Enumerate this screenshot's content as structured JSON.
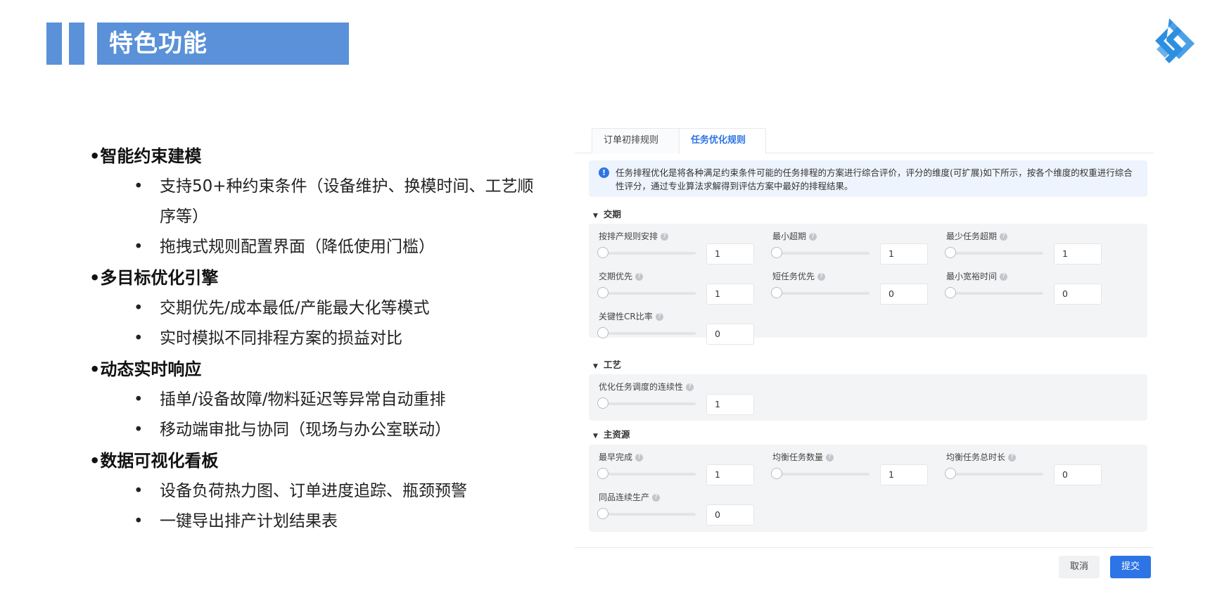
{
  "header": {
    "title": "特色功能",
    "logo_icon": "company-logo-icon",
    "accent_color": "#5a91d9"
  },
  "features": [
    {
      "title": "•智能约束建模",
      "bullets": [
        {
          "line1": "支持50+种约束条件（设备维护、换模时间、工艺顺",
          "line2": "序等）"
        },
        {
          "line1": "拖拽式规则配置界面（降低使用门槛）"
        }
      ]
    },
    {
      "title": "•多目标优化引擎",
      "bullets": [
        {
          "line1": "交期优先/成本最低/产能最大化等模式"
        },
        {
          "line1": "实时模拟不同排程方案的损益对比"
        }
      ]
    },
    {
      "title": "•动态实时响应",
      "bullets": [
        {
          "line1": "插单/设备故障/物料延迟等异常自动重排"
        },
        {
          "line1": "移动端审批与协同（现场与办公室联动）"
        }
      ]
    },
    {
      "title": "•数据可视化看板",
      "bullets": [
        {
          "line1": "设备负荷热力图、订单进度追踪、瓶颈预警"
        },
        {
          "line1": "一键导出排产计划结果表"
        }
      ]
    }
  ],
  "panel": {
    "tabs": [
      {
        "label": "订单初排规则",
        "active": false
      },
      {
        "label": "任务优化规则",
        "active": true
      }
    ],
    "info_text": "任务排程优化是将各种满足约束条件可能的任务排程的方案进行综合评价，评分的维度(可扩展)如下所示，按各个维度的权重进行综合性评分，通过专业算法求解得到评估方案中最好的排程结果。",
    "groups": [
      {
        "title": "交期",
        "params": [
          {
            "label": "按排产规则安排",
            "value": "1"
          },
          {
            "label": "最小超期",
            "value": "1"
          },
          {
            "label": "最少任务超期",
            "value": "1"
          },
          {
            "label": "交期优先",
            "value": "1"
          },
          {
            "label": "短任务优先",
            "value": "0"
          },
          {
            "label": "最小宽裕时间",
            "value": "0"
          },
          {
            "label": "关键性CR比率",
            "value": "0"
          }
        ]
      },
      {
        "title": "工艺",
        "params": [
          {
            "label": "优化任务调度的连续性",
            "value": "1"
          }
        ]
      },
      {
        "title": "主资源",
        "params": [
          {
            "label": "最早完成",
            "value": "1"
          },
          {
            "label": "均衡任务数量",
            "value": "1"
          },
          {
            "label": "均衡任务总时长",
            "value": "0"
          },
          {
            "label": "同品连续生产",
            "value": "0"
          }
        ]
      }
    ],
    "buttons": {
      "cancel": "取消",
      "submit": "提交"
    },
    "primary_color": "#2d74e6"
  }
}
